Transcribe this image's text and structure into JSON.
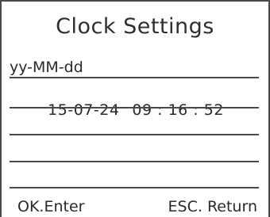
{
  "screen": {
    "title": "Clock Settings",
    "format_label": "yy-MM-dd",
    "date_value": "15-07-24",
    "time_value": "09 : 16 : 52"
  },
  "footer": {
    "ok_label": "OK.Enter",
    "esc_label": "ESC. Return"
  }
}
